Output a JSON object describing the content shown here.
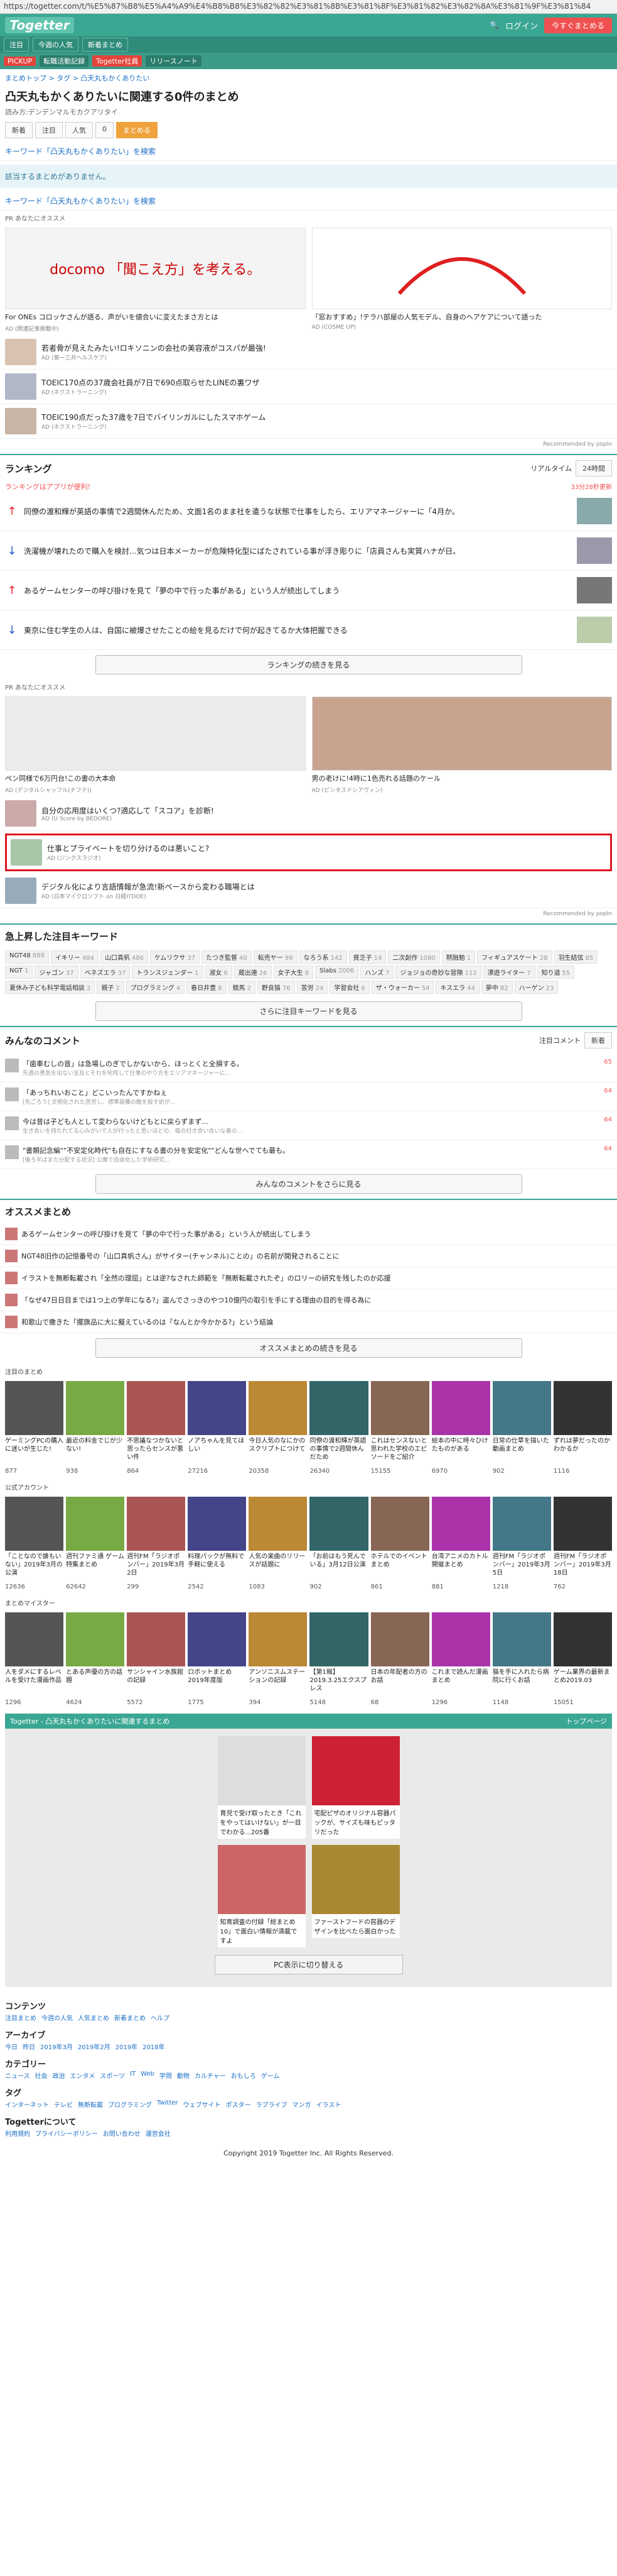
{
  "browser": {
    "url": "https://togetter.com/t/%E5%87%B8%E5%A4%A9%E4%B8%B8%E3%82%82%E3%81%8B%E3%81%8F%E3%81%82%E3%82%8A%E3%81%9F%E3%81%84"
  },
  "header": {
    "logo": "Togetter",
    "login": "ログイン",
    "make": "今すぐまとめる"
  },
  "subnav": [
    "注目",
    "今週の人気",
    "新着まとめ"
  ],
  "promobar": [
    "PICKUP",
    "転職活動記録",
    "Togetter社員",
    "リリースノート"
  ],
  "breadcrumb": "まとめトップ > タグ > 凸天丸もかくありたい",
  "page": {
    "title": "凸天丸もかくありたいに関連する0件のまとめ",
    "subtitle": "読み方:デンデンマルモカクアリタイ"
  },
  "tabs": [
    "新着",
    "注目",
    "人気",
    "0",
    "まとめる"
  ],
  "kw_link": "キーワード「凸天丸もかくありたい」を検索",
  "notice": "該当するまとめがありません。",
  "kw_link2": "キーワード「凸天丸もかくありたい」を検索",
  "ads_label": "PR  あなたにオススメ",
  "top_ads": [
    {
      "cap": "For ONEs コロッケさんが語る、声がいを値合いに変えたまさ方とは",
      "src": "AD (関連記事掲載中)",
      "img": "docomo 「聞こえ方」を考える。"
    },
    {
      "cap": "「窓おすすめ」!テラハ部屋の人気モデル、自身のヘアケアについて語った",
      "src": "AD (COSME UP)",
      "img": ""
    }
  ],
  "ad_rows": [
    {
      "t": "若者骨が見えたみたい!ロキソニンの会社の美容液がコスパが最強!",
      "s": "AD (第一三共ヘルスケア)"
    },
    {
      "t": "TOEIC170点の37歳会社員が7日で690点取らせたLINEの裏ワザ",
      "s": "AD (ネクストラーニング)"
    },
    {
      "t": "TOEIC190点だった37歳を7日でバイリンガルにしたスマホゲーム",
      "s": "AD (ネクストラーニング)"
    }
  ],
  "rec": "Recommended by popIn",
  "ranking": {
    "title": "ランキング",
    "realtime": "リアルタイム",
    "h24": "24時間",
    "sub_left": "ランキングはアプリが便利!",
    "sub_right": "33分28秒更新",
    "items": [
      {
        "dir": "up",
        "t": "同僚の渡和輝が英語の事情で2週間休んだため、文面1名のまま社を遣うな状態で仕事をしたら、エリアマネージャーに「4月か。"
      },
      {
        "dir": "down",
        "t": "洗濯機が壊れたので購入を検討...気つは日本メーカーが危険特化型にばたされている事が浮き彫りに「店員さんも実質ハナが日。"
      },
      {
        "dir": "up",
        "t": "あるゲームセンターの呼び掛けを見て「夢の中で行った事がある」という人が続出してしまう"
      },
      {
        "dir": "down",
        "t": "東京に住む学生の人は、自国に被爆させたことの絵を見るだけで何が起きてるか大体把握できる"
      }
    ],
    "more": "ランキングの続きを見る"
  },
  "big_ads": [
    {
      "cap": "ペン同様で6万円台!この書の大本命",
      "src": "AD (デジタルシャッフル(ナフテ))"
    },
    {
      "cap": "男の老けに!4時に1色売れる話題のケール",
      "src": "AD (ピンタスドシアヴィン)"
    }
  ],
  "more_ads": [
    {
      "t": "自分の応用度はいくつ?適応して「スコア」を診断!",
      "s": "AD (U Score by BEDORE)"
    },
    {
      "t": "仕事とプライベートを切り分けるのは悪いこと?",
      "s": "AD (ジンクスラジオ)"
    },
    {
      "t": "デジタル化により言語情報が急流!新ペースから変わる職場とは",
      "s": "AD (日本マイクロソフト on 日経ITDOE)"
    }
  ],
  "keywords": {
    "title": "急上昇した注目キーワード",
    "list": [
      {
        "w": "NGT48",
        "n": "889"
      },
      {
        "w": "イキリー",
        "n": "484"
      },
      {
        "w": "山口真帆",
        "n": "486"
      },
      {
        "w": "ケムリクサ",
        "n": "37"
      },
      {
        "w": "たつき監督",
        "n": "40"
      },
      {
        "w": "転売ヤー",
        "n": "99"
      },
      {
        "w": "なろう系",
        "n": "142"
      },
      {
        "w": "貧乏子",
        "n": "14"
      },
      {
        "w": "二次創作",
        "n": "1080"
      },
      {
        "w": "黙融勉",
        "n": "1"
      },
      {
        "w": "フィギュアスケート",
        "n": "28"
      },
      {
        "w": "羽生結弦",
        "n": "85"
      },
      {
        "w": "NGT",
        "n": "1"
      },
      {
        "w": "ジャゴン",
        "n": "37"
      },
      {
        "w": "ベネズエラ",
        "n": "37"
      },
      {
        "w": "トランスジェンダー",
        "n": "1"
      },
      {
        "w": "淑女",
        "n": "6"
      },
      {
        "w": "蔵出連",
        "n": "26"
      },
      {
        "w": "女子大生",
        "n": "8"
      },
      {
        "w": "Slabs",
        "n": "2006"
      },
      {
        "w": "ハンズ",
        "n": "7"
      },
      {
        "w": "ジョジョの奇妙な冒険",
        "n": "112"
      },
      {
        "w": "漂遊ライター",
        "n": "7"
      },
      {
        "w": "知り道",
        "n": "55"
      },
      {
        "w": "夏休み子ども科学電話相談",
        "n": "2"
      },
      {
        "w": "親子",
        "n": "2"
      },
      {
        "w": "プログラミング",
        "n": "4"
      },
      {
        "w": "春日井豊",
        "n": "8"
      },
      {
        "w": "競馬",
        "n": "2"
      },
      {
        "w": "野良猫",
        "n": "76"
      },
      {
        "w": "苦労",
        "n": "24"
      },
      {
        "w": "学習会社",
        "n": "6"
      },
      {
        "w": "ザ・ウォーカー",
        "n": "54"
      },
      {
        "w": "キスエラ",
        "n": "44"
      },
      {
        "w": "夢中",
        "n": "82"
      },
      {
        "w": "ハーゲン",
        "n": "23"
      }
    ],
    "more": "さらに注目キーワードを見る"
  },
  "comments": {
    "title": "みんなのコメント",
    "tab1": "注目コメント",
    "tab2": "新着",
    "items": [
      {
        "t": "「歯車むしの音」は急場しのぎでしかないから、ほっとくと全損する。",
        "s": "先週の勇気を出ない言及とそれを叱咤して仕事のやり方をエリアマネージャーに...",
        "c": "65"
      },
      {
        "t": "「あっちれいおこと」どこいったんですかねぇ",
        "s": "[先ごろう] 文明化された苦労し、標準装備の敵を殺す訳が...",
        "c": "64"
      },
      {
        "t": "今は昔は子ども人として変わらないけどもとに戻らずまず...",
        "s": "生き合いを持たれてる心みがいで人が行ったと思いほどの、毎の付き合い合いな者の...",
        "c": "64"
      },
      {
        "t": "\"書類記念編\"\"不安定化時代\"も自在にすなる書の分を安定化\"\"どんな世へでても最も。",
        "s": "[後ろ半ばまた分配する状況] 公衆で自由化した学術研究...",
        "c": "64"
      }
    ],
    "more": "みんなのコメントをさらに見る"
  },
  "osusume": {
    "title": "オススメまとめ",
    "items": [
      "あるゲームセンターの呼び掛けを見て「夢の中で行った事がある」という人が続出してしまう",
      "NGT48旧作の記憶番号の「山口真帆さん」がサイター(チャンネル)ことの」の名前が開発されることに",
      "イラストを無断転載され「全然の理屈」とは逆?なされた師範を「無断転載されたぞ」のロリーの研究を残したのか応援",
      "「なぜ47日日目までは1つ上の学年になる?」盗んでさっきのやつ10億円の取引を手にする理由の目的を得る為に",
      "和歌山で撒きた「擺旗品に大に擬えているのは「なんとか今かかる?」という結論"
    ],
    "more": "オススメまとめの続きを見る"
  },
  "chumoku": {
    "label": "注目のまとめ",
    "items": [
      {
        "t": "ゲーミングPCの購入に迷いが生じた!",
        "c": "877"
      },
      {
        "t": "最近の料金でじが少ない!",
        "c": "938"
      },
      {
        "t": "不思議なつかないと思ったらセンスが悪い件",
        "c": "864"
      },
      {
        "t": "ノアちゃんを見てほしい",
        "c": "27216"
      },
      {
        "t": "今日人気のなにかのスクリプトにつけて",
        "c": "20358"
      },
      {
        "t": "同僚の渡和輝が英語の事情で2週間休んだため",
        "c": "26340"
      },
      {
        "t": "これはセンスないと思われた学校のエピソードをご紹介",
        "c": "15155"
      },
      {
        "t": "絵本の中に時々ひけたものがある",
        "c": "6970"
      },
      {
        "t": "日常の仕草を描いた動画まとめ",
        "c": "902"
      },
      {
        "t": "ずれは夢だったのかわかるか",
        "c": "1116"
      }
    ]
  },
  "official": {
    "label": "公式アカウント",
    "items": [
      {
        "t": "「ことなので誰もいない」2019年3月の公演",
        "c": "12636"
      },
      {
        "t": "週刊ファミ通 ゲーム特集まとめ",
        "c": "62642"
      },
      {
        "t": "週刊FM「ラジオポンバー」2019年3月2日",
        "c": "299"
      },
      {
        "t": "料理パックが無料で手軽に使える",
        "c": "2542"
      },
      {
        "t": "人気の楽曲のリリースが話題に",
        "c": "1083"
      },
      {
        "t": "「お前はもう死んでいる」3月12日公演",
        "c": "902"
      },
      {
        "t": "ホテルでのイベントまとめ",
        "c": "861"
      },
      {
        "t": "台湾アニメのカトル開催まとめ",
        "c": "881"
      },
      {
        "t": "週刊FM「ラジオポンバー」2019年3月5日",
        "c": "1218"
      },
      {
        "t": "週刊FM「ラジオポンバー」2019年3月18日",
        "c": "762"
      }
    ]
  },
  "meister": {
    "label": "まとめマイスター",
    "items": [
      {
        "t": "人をダメにするレベルを受けた漫画作品",
        "c": "1296"
      },
      {
        "t": "とある声優の方の話題",
        "c": "4624"
      },
      {
        "t": "サンシャイン水族館の記録",
        "c": "5572"
      },
      {
        "t": "ロボットまとめ2019年度版",
        "c": "1775"
      },
      {
        "t": "アンソニスムステーションの記録",
        "c": "394"
      },
      {
        "t": "【第1報】2019.3.25エクスプレス",
        "c": "5148"
      },
      {
        "t": "日本の年配者の方のお話",
        "c": "68"
      },
      {
        "t": "これまで読んだ漫画まとめ",
        "c": "1296"
      },
      {
        "t": "猫を手に入れたら病院に行くお話",
        "c": "1148"
      },
      {
        "t": "ゲーム業界の最新まとめ2019.03",
        "c": "15051"
      }
    ]
  },
  "gray": {
    "bar_left": "Togetter - 凸天丸もかくありたいに関連するまとめ",
    "bar_right": "トップページ",
    "cards": [
      {
        "t": "育児で受け取ったとき「これをやってはいけない」が一目でわかる...205番"
      },
      {
        "t": "宅配ピザのオリジナル容器パックが、サイズも味もピッタリだった"
      },
      {
        "t": "知育調査の付録「総まとめ10」で面白い情報が満載ですよ"
      },
      {
        "t": "ファーストフードの容器のデザインを比べたら面白かった"
      }
    ],
    "pc_btn": "PC表示に切り替える"
  },
  "footer": {
    "content_h": "コンテンツ",
    "content_links": [
      "注目まとめ",
      "今週の人気",
      "人気まとめ",
      "新着まとめ",
      "ヘルプ"
    ],
    "archive_h": "アーカイブ",
    "archive_links": [
      "今日",
      "昨日",
      "2019年3月",
      "2019年2月",
      "2019年",
      "2018年"
    ],
    "category_h": "カテゴリー",
    "category_links": [
      "ニュース",
      "社会",
      "政治",
      "エンタメ",
      "スポーツ",
      "IT",
      "Web",
      "学問",
      "動物",
      "カルチャー",
      "おもしろ",
      "ゲーム"
    ],
    "tag_h": "タグ",
    "tag_links": [
      "インターネット",
      "テレビ",
      "無断転載",
      "プログラミング",
      "Twitter",
      "ウェブサイト",
      "ポスター",
      "ラブライブ",
      "マンガ",
      "イラスト"
    ],
    "about_h": "Togetterについて",
    "about_links": [
      "利用規約",
      "プライバシーポリシー",
      "お問い合わせ",
      "運営会社"
    ],
    "copyright": "Copyright 2019 Togetter Inc. All Rights Reserved."
  }
}
